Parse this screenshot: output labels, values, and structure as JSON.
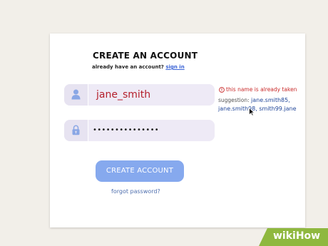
{
  "form": {
    "title": "CREATE AN ACCOUNT",
    "subtitle_text": "already have an account?",
    "signin_link": "sign in",
    "username_value": "jane_smith",
    "password_value": "•••••••••••••••",
    "error_message": "this name is already taken",
    "suggestion_label": "suggestion:",
    "suggestion_line1": "jane.smith85,",
    "suggestion_line2": "jane.smith98, smith99.jane",
    "create_button": "CREATE ACCOUNT",
    "forgot_link": "forgot password?"
  },
  "icons": {
    "username_icon": "user-icon",
    "password_icon": "lock-icon",
    "error_icon": "alert-circle-icon",
    "cursor_icon": "mouse-pointer-icon"
  },
  "colors": {
    "background": "#f2efe9",
    "card": "#ffffff",
    "input_bg": "#eeeaf6",
    "error_text": "#c92a2a",
    "username_text": "#b41f2b",
    "link": "#3b64d6",
    "suggestion_names": "#23489a",
    "button": "#86a9ee",
    "watermark": "#8fb83f"
  },
  "watermark": {
    "text": "wikiHow"
  }
}
